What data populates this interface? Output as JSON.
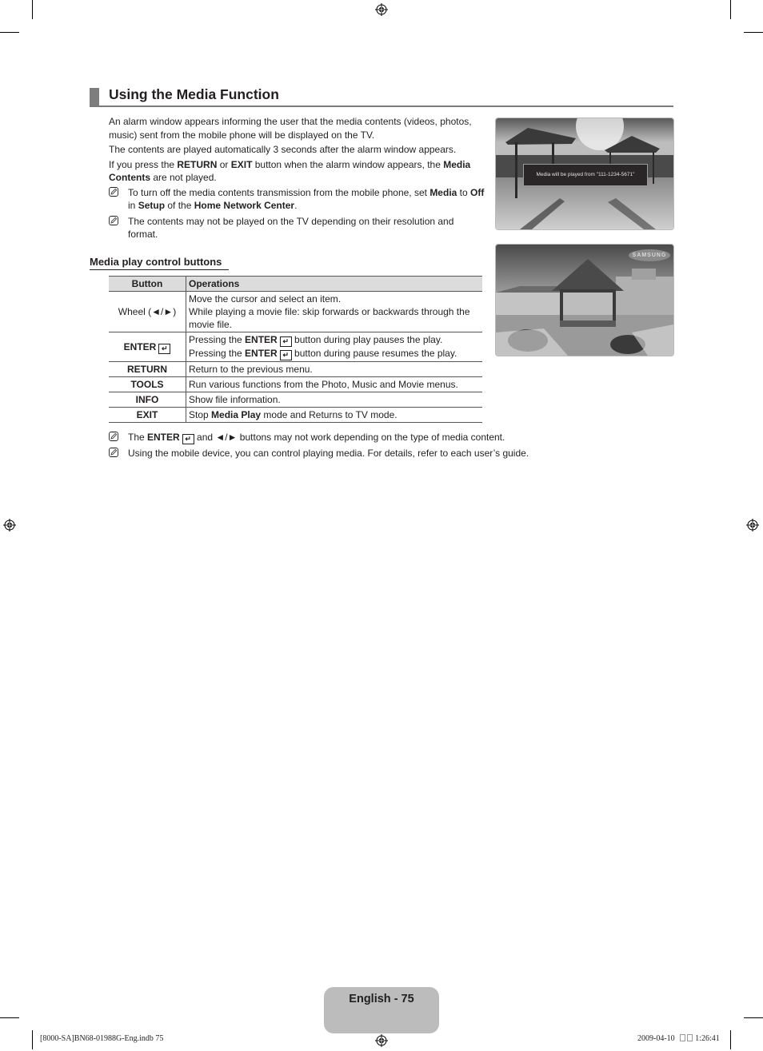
{
  "section": {
    "title": "Using the Media Function"
  },
  "intro": {
    "p1": "An alarm window appears informing the user that the media contents (videos, photos, music) sent from the mobile phone will be displayed on the TV.",
    "p2": "The contents are played automatically 3 seconds after the alarm window appears.",
    "p3": {
      "t1": "If you press the ",
      "b1": "RETURN",
      "t2": " or ",
      "b2": "EXIT",
      "t3": " button when the alarm window appears, the ",
      "b3": "Media Contents",
      "t4": " are not played."
    },
    "note1": {
      "t1": "To turn off the media contents transmission from the mobile phone, set ",
      "b1": "Media",
      "t2": " to ",
      "b2": "Off",
      "t3": " in ",
      "b3": "Setup",
      "t4": " of the ",
      "b4": "Home Network Center",
      "t5": "."
    },
    "note2": "The contents may not be played on the TV depending on their resolution and format."
  },
  "subsection": {
    "title": "Media play control buttons"
  },
  "table": {
    "headers": [
      "Button",
      "Operations"
    ],
    "rows": [
      {
        "button": "Wheel (◄/►)",
        "line1": "Move the cursor and select an item.",
        "line2": "While playing a movie file: skip forwards or backwards through the movie file."
      },
      {
        "button": "ENTER",
        "line1_a": "Pressing the ",
        "line1_b": "ENTER",
        "line1_c": " button during play pauses the play.",
        "line2_a": "Pressing the ",
        "line2_b": "ENTER",
        "line2_c": " button during pause resumes the play."
      },
      {
        "button": "RETURN",
        "op": "Return to the previous menu."
      },
      {
        "button": "TOOLS",
        "op": "Run various functions from the Photo, Music and Movie menus."
      },
      {
        "button": "INFO",
        "op": "Show file information."
      },
      {
        "button": "EXIT",
        "op_a": "Stop ",
        "op_b": "Media Play",
        "op_c": " mode and Returns to TV mode."
      }
    ]
  },
  "bottom_notes": {
    "note1": {
      "t1": "The ",
      "b1": "ENTER",
      "t2": " and ◄/► buttons may not work depending on the type of media content."
    },
    "note2": "Using the mobile device, you can control playing media. For details, refer to each user’s guide."
  },
  "images": {
    "beach": {
      "alarm_text": "Media will be played from \"111-1234-5671\""
    },
    "gazebo": {
      "brand": "SAMSUNG"
    }
  },
  "page": {
    "label": "English - 75"
  },
  "footer": {
    "left": "[8000-SA]BN68-01988G-Eng.indb   75",
    "date": "2009-04-10",
    "time": "1:26:41"
  },
  "icons": {
    "note": "note-pencil-icon",
    "enter": "enter-key-icon",
    "registration": "registration-mark-icon"
  }
}
